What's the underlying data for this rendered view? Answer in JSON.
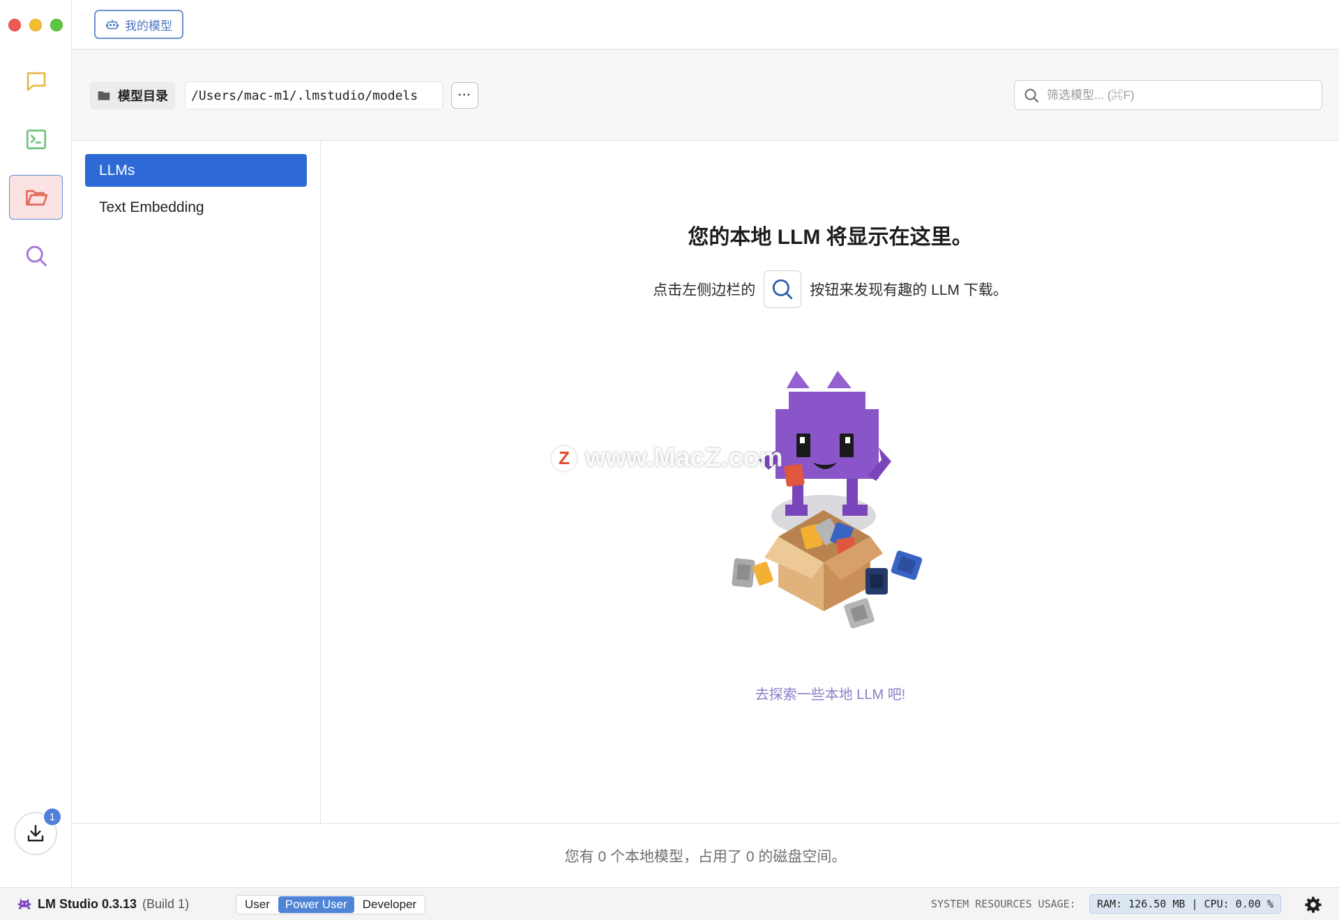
{
  "top_tab": {
    "label": "我的模型"
  },
  "toolbar": {
    "dir_label": "模型目录",
    "dir_path": "/Users/mac-m1/.lmstudio/models",
    "more_label": "···",
    "search_placeholder": "筛选模型... (⌘F)"
  },
  "categories": [
    {
      "label": "LLMs",
      "selected": true
    },
    {
      "label": "Text Embedding",
      "selected": false
    }
  ],
  "empty_state": {
    "title": "您的本地 LLM 将显示在这里。",
    "hint_before": "点击左侧边栏的",
    "hint_after": "按钮来发现有趣的 LLM 下载。",
    "explore_link": "去探索一些本地 LLM 吧!"
  },
  "watermark": {
    "logo": "Z",
    "text": "www.MacZ.com"
  },
  "summary": "您有 0 个本地模型，占用了 0 的磁盘空间。",
  "downloads": {
    "badge_count": "1"
  },
  "status_bar": {
    "app_name": "LM Studio 0.3.13",
    "build": "(Build 1)",
    "modes": [
      "User",
      "Power User",
      "Developer"
    ],
    "active_mode": "Power User",
    "resources_label": "SYSTEM RESOURCES USAGE:",
    "resources_value": "RAM: 126.50 MB  |  CPU: 0.00 %"
  },
  "icons": {
    "chat": "chat-bubble-icon",
    "terminal": "terminal-icon",
    "models": "folder-open-icon",
    "discover": "search-icon",
    "download": "download-icon",
    "settings": "gear-icon"
  },
  "colors": {
    "accent": "#2e6ad6",
    "chat_icon": "#e8b84a",
    "terminal_icon": "#6fc27e",
    "folder_icon": "#e26a5c",
    "search_icon": "#a678d8",
    "mascot": "#8a55c8"
  }
}
